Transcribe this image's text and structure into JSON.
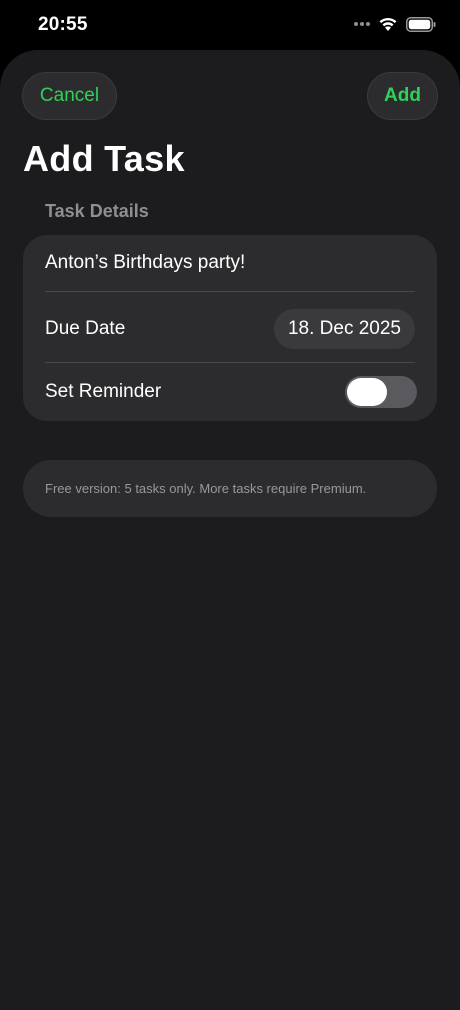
{
  "status_bar": {
    "time": "20:55"
  },
  "nav": {
    "cancel_label": "Cancel",
    "add_label": "Add"
  },
  "page": {
    "title": "Add Task"
  },
  "form": {
    "section_header": "Task Details",
    "task_title_value": "Anton’s Birthdays party!",
    "due_date_label": "Due Date",
    "due_date_value": "18. Dec 2025",
    "reminder_label": "Set Reminder",
    "reminder_enabled": false
  },
  "notice": {
    "text": "Free version: 5 tasks only. More tasks require Premium."
  },
  "colors": {
    "accent": "#30d158",
    "background": "#1c1c1e",
    "card": "#2c2c2e"
  },
  "icons": [
    "signal-dots-icon",
    "wifi-icon",
    "battery-icon"
  ]
}
